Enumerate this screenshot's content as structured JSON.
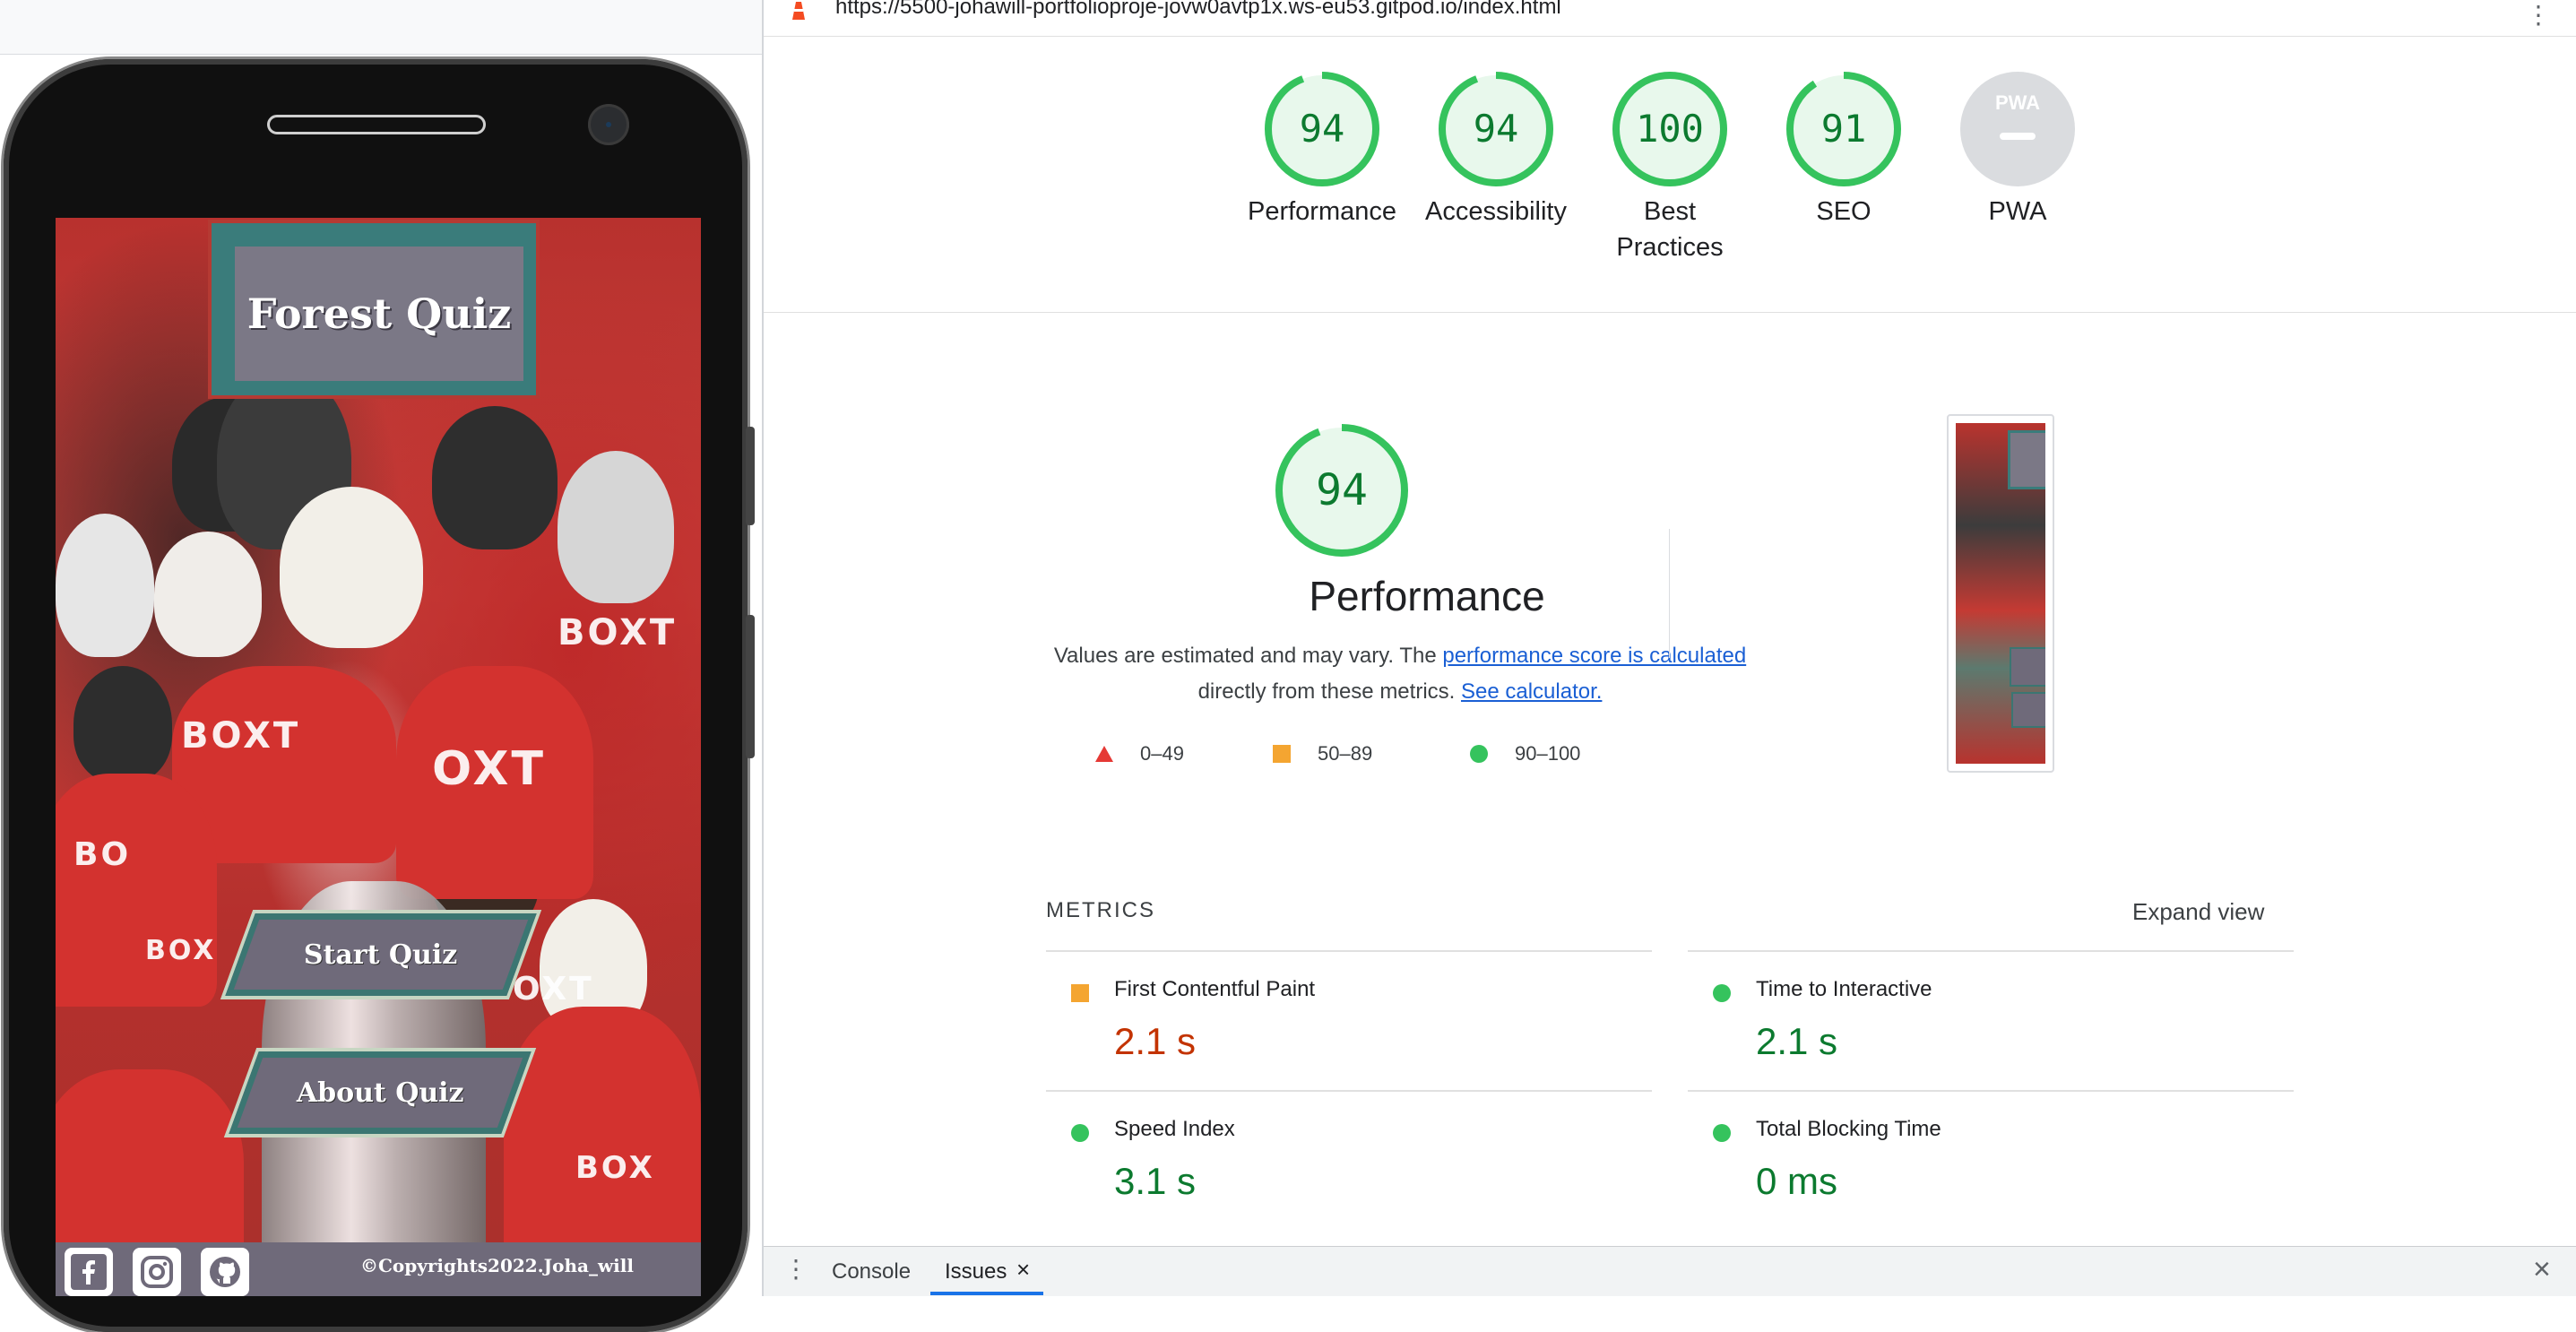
{
  "device_preview": {
    "app_title": "Forest Quiz",
    "buttons": {
      "start": "Start Quiz",
      "about": "About Quiz"
    },
    "sponsor_text": [
      "BOXT",
      "OXT",
      "BOX",
      "BO"
    ],
    "footer": {
      "copyright": "©Copyrights2022.Joha_will"
    },
    "social_icons": [
      "facebook-icon",
      "instagram-icon",
      "github-icon"
    ]
  },
  "lighthouse": {
    "url": "https://5500-johawill-portfolioproje-jovw0avtp1x.ws-eu53.gitpod.io/index.html",
    "gauges": [
      {
        "score": "94",
        "label": "Performance"
      },
      {
        "score": "94",
        "label": "Accessibility"
      },
      {
        "score": "100",
        "label": "Best Practices"
      },
      {
        "score": "91",
        "label": "SEO"
      },
      {
        "score": "PWA",
        "label": "PWA"
      }
    ],
    "performance": {
      "score": "94",
      "title": "Performance",
      "description_before": "Values are estimated and may vary. The ",
      "link1": "performance score is calculated",
      "description_middle": " directly from these metrics. ",
      "link2": "See calculator."
    },
    "legend": [
      {
        "range": "0–49",
        "color": "#e53935"
      },
      {
        "range": "50–89",
        "color": "#f4a531"
      },
      {
        "range": "90–100",
        "color": "#35c35d"
      }
    ],
    "metrics_heading": "METRICS",
    "expand_view": "Expand view",
    "metrics": [
      {
        "label": "First Contentful Paint",
        "value": "2.1 s",
        "status": "average"
      },
      {
        "label": "Time to Interactive",
        "value": "2.1 s",
        "status": "pass"
      },
      {
        "label": "Speed Index",
        "value": "3.1 s",
        "status": "pass"
      },
      {
        "label": "Total Blocking Time",
        "value": "0 ms",
        "status": "pass"
      }
    ],
    "colors": {
      "pass": "#0c7a2f",
      "average": "#c33300",
      "gauge_ring": "#35c35d",
      "gauge_fill": "#e8f8ec",
      "link": "#1a5fd4"
    }
  },
  "drawer": {
    "tabs": [
      {
        "label": "Console"
      },
      {
        "label": "Issues",
        "active": true
      }
    ],
    "close_glyph": "×"
  }
}
